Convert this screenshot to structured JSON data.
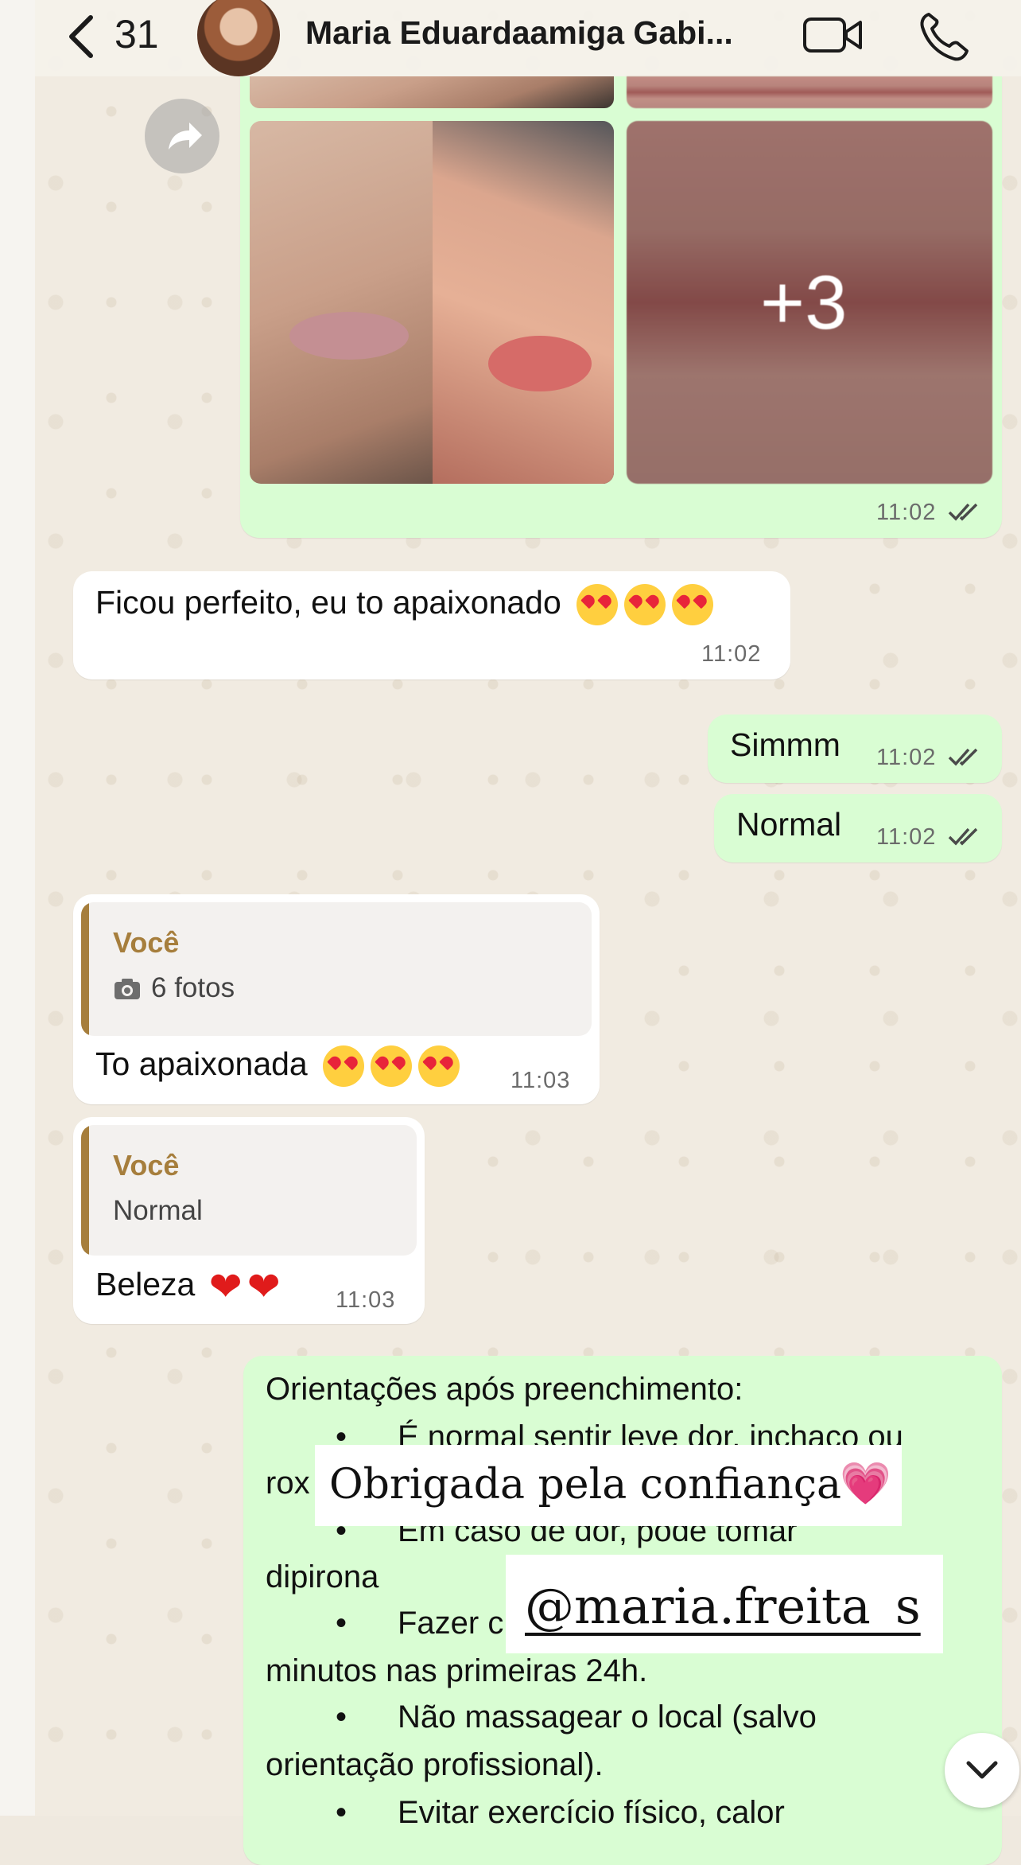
{
  "header": {
    "back_count": "31",
    "contact_name": "Maria Eduardaamiga Gabi..."
  },
  "photo_message": {
    "more_count": "+3",
    "time": "11:02"
  },
  "messages": [
    {
      "text": "Ficou perfeito, eu to apaixonado",
      "time": "11:02",
      "emoji": "heart-eyes",
      "emoji_count": 3
    },
    {
      "text": "Simmm",
      "time": "11:02"
    },
    {
      "text": "Normal",
      "time": "11:02"
    },
    {
      "quote_author": "Você",
      "quote_text": "6 fotos",
      "text": "To apaixonada",
      "time": "11:03",
      "emoji": "heart-eyes",
      "emoji_count": 3
    },
    {
      "quote_author": "Você",
      "quote_text": "Normal",
      "text": "Beleza",
      "time": "11:03",
      "emoji": "red-heart",
      "emoji_count": 2
    }
  ],
  "instructions": {
    "title": "Orientações após preenchimento:",
    "lines": [
      "É normal sentir leve dor, inchaço ou",
      "rox",
      "Em caso de dor, pode tomar",
      "dipirona",
      "Fazer c",
      "minutos nas primeiras 24h.",
      "Não massagear o local (salvo",
      "orientação profissional).",
      "Evitar exercício físico, calor"
    ]
  },
  "overlays": {
    "thanks_text": "Obrigada pela confiança",
    "thanks_emoji": "💗",
    "handle": "@maria.freita_s"
  },
  "icons": {
    "back": "chevron-left-icon",
    "video": "video-camera-icon",
    "phone": "phone-icon",
    "forward": "forward-icon",
    "camera": "camera-icon",
    "scroll": "chevron-down-icon",
    "read": "double-check-icon"
  },
  "colors": {
    "outgoing_bubble": "#d9fdd3",
    "incoming_bubble": "#ffffff",
    "quote_accent": "#a67e3c",
    "read_ticks": "#4a4a4a"
  }
}
